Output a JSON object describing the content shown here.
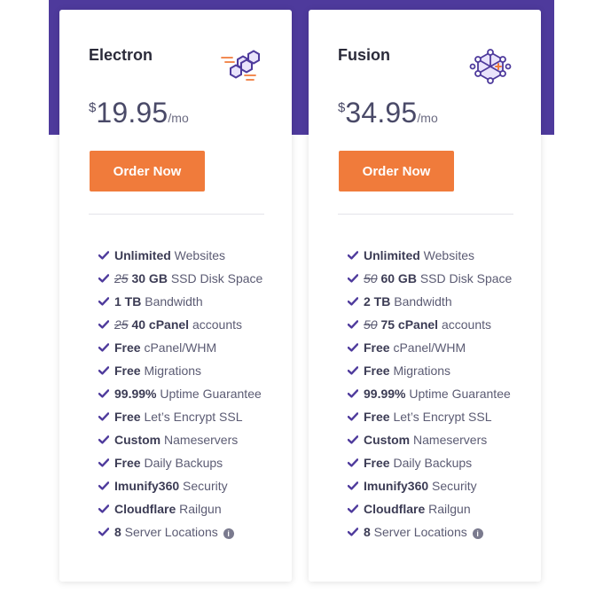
{
  "colors": {
    "brand_purple": "#4e3a9c",
    "accent_orange": "#f07b3b",
    "check_purple": "#4e3a9c"
  },
  "plans": [
    {
      "name": "Electron",
      "icon": "hexagon-cluster-icon",
      "currency": "$",
      "price": "19.95",
      "period": "/mo",
      "order_label": "Order Now",
      "features": [
        {
          "strong": "Unlimited",
          "text": " Websites"
        },
        {
          "old": "25",
          "strong": "30 GB",
          "text": " SSD Disk Space"
        },
        {
          "strong": "1 TB",
          "text": " Bandwidth"
        },
        {
          "old": "25",
          "strong": "40 cPanel",
          "text": " accounts"
        },
        {
          "strong": "Free",
          "text": " cPanel/WHM"
        },
        {
          "strong": "Free",
          "text": " Migrations"
        },
        {
          "strong": "99.99%",
          "text": " Uptime Guarantee"
        },
        {
          "strong": "Free",
          "text": " Let’s Encrypt SSL"
        },
        {
          "strong": "Custom",
          "text": " Nameservers"
        },
        {
          "strong": "Free",
          "text": " Daily Backups"
        },
        {
          "strong": "Imunify360",
          "text": " Security"
        },
        {
          "strong": "Cloudflare",
          "text": " Railgun"
        },
        {
          "strong": "8",
          "text": " Server Locations",
          "info": true
        }
      ]
    },
    {
      "name": "Fusion",
      "icon": "atom-network-icon",
      "currency": "$",
      "price": "34.95",
      "period": "/mo",
      "order_label": "Order Now",
      "features": [
        {
          "strong": "Unlimited",
          "text": " Websites"
        },
        {
          "old": "50",
          "strong": "60 GB",
          "text": " SSD Disk Space"
        },
        {
          "strong": "2 TB",
          "text": " Bandwidth"
        },
        {
          "old": "50",
          "strong": "75 cPanel",
          "text": " accounts"
        },
        {
          "strong": "Free",
          "text": " cPanel/WHM"
        },
        {
          "strong": "Free",
          "text": " Migrations"
        },
        {
          "strong": "99.99%",
          "text": " Uptime Guarantee"
        },
        {
          "strong": "Free",
          "text": " Let’s Encrypt SSL"
        },
        {
          "strong": "Custom",
          "text": " Nameservers"
        },
        {
          "strong": "Free",
          "text": " Daily Backups"
        },
        {
          "strong": "Imunify360",
          "text": " Security"
        },
        {
          "strong": "Cloudflare",
          "text": " Railgun"
        },
        {
          "strong": "8",
          "text": " Server Locations",
          "info": true
        }
      ]
    }
  ]
}
